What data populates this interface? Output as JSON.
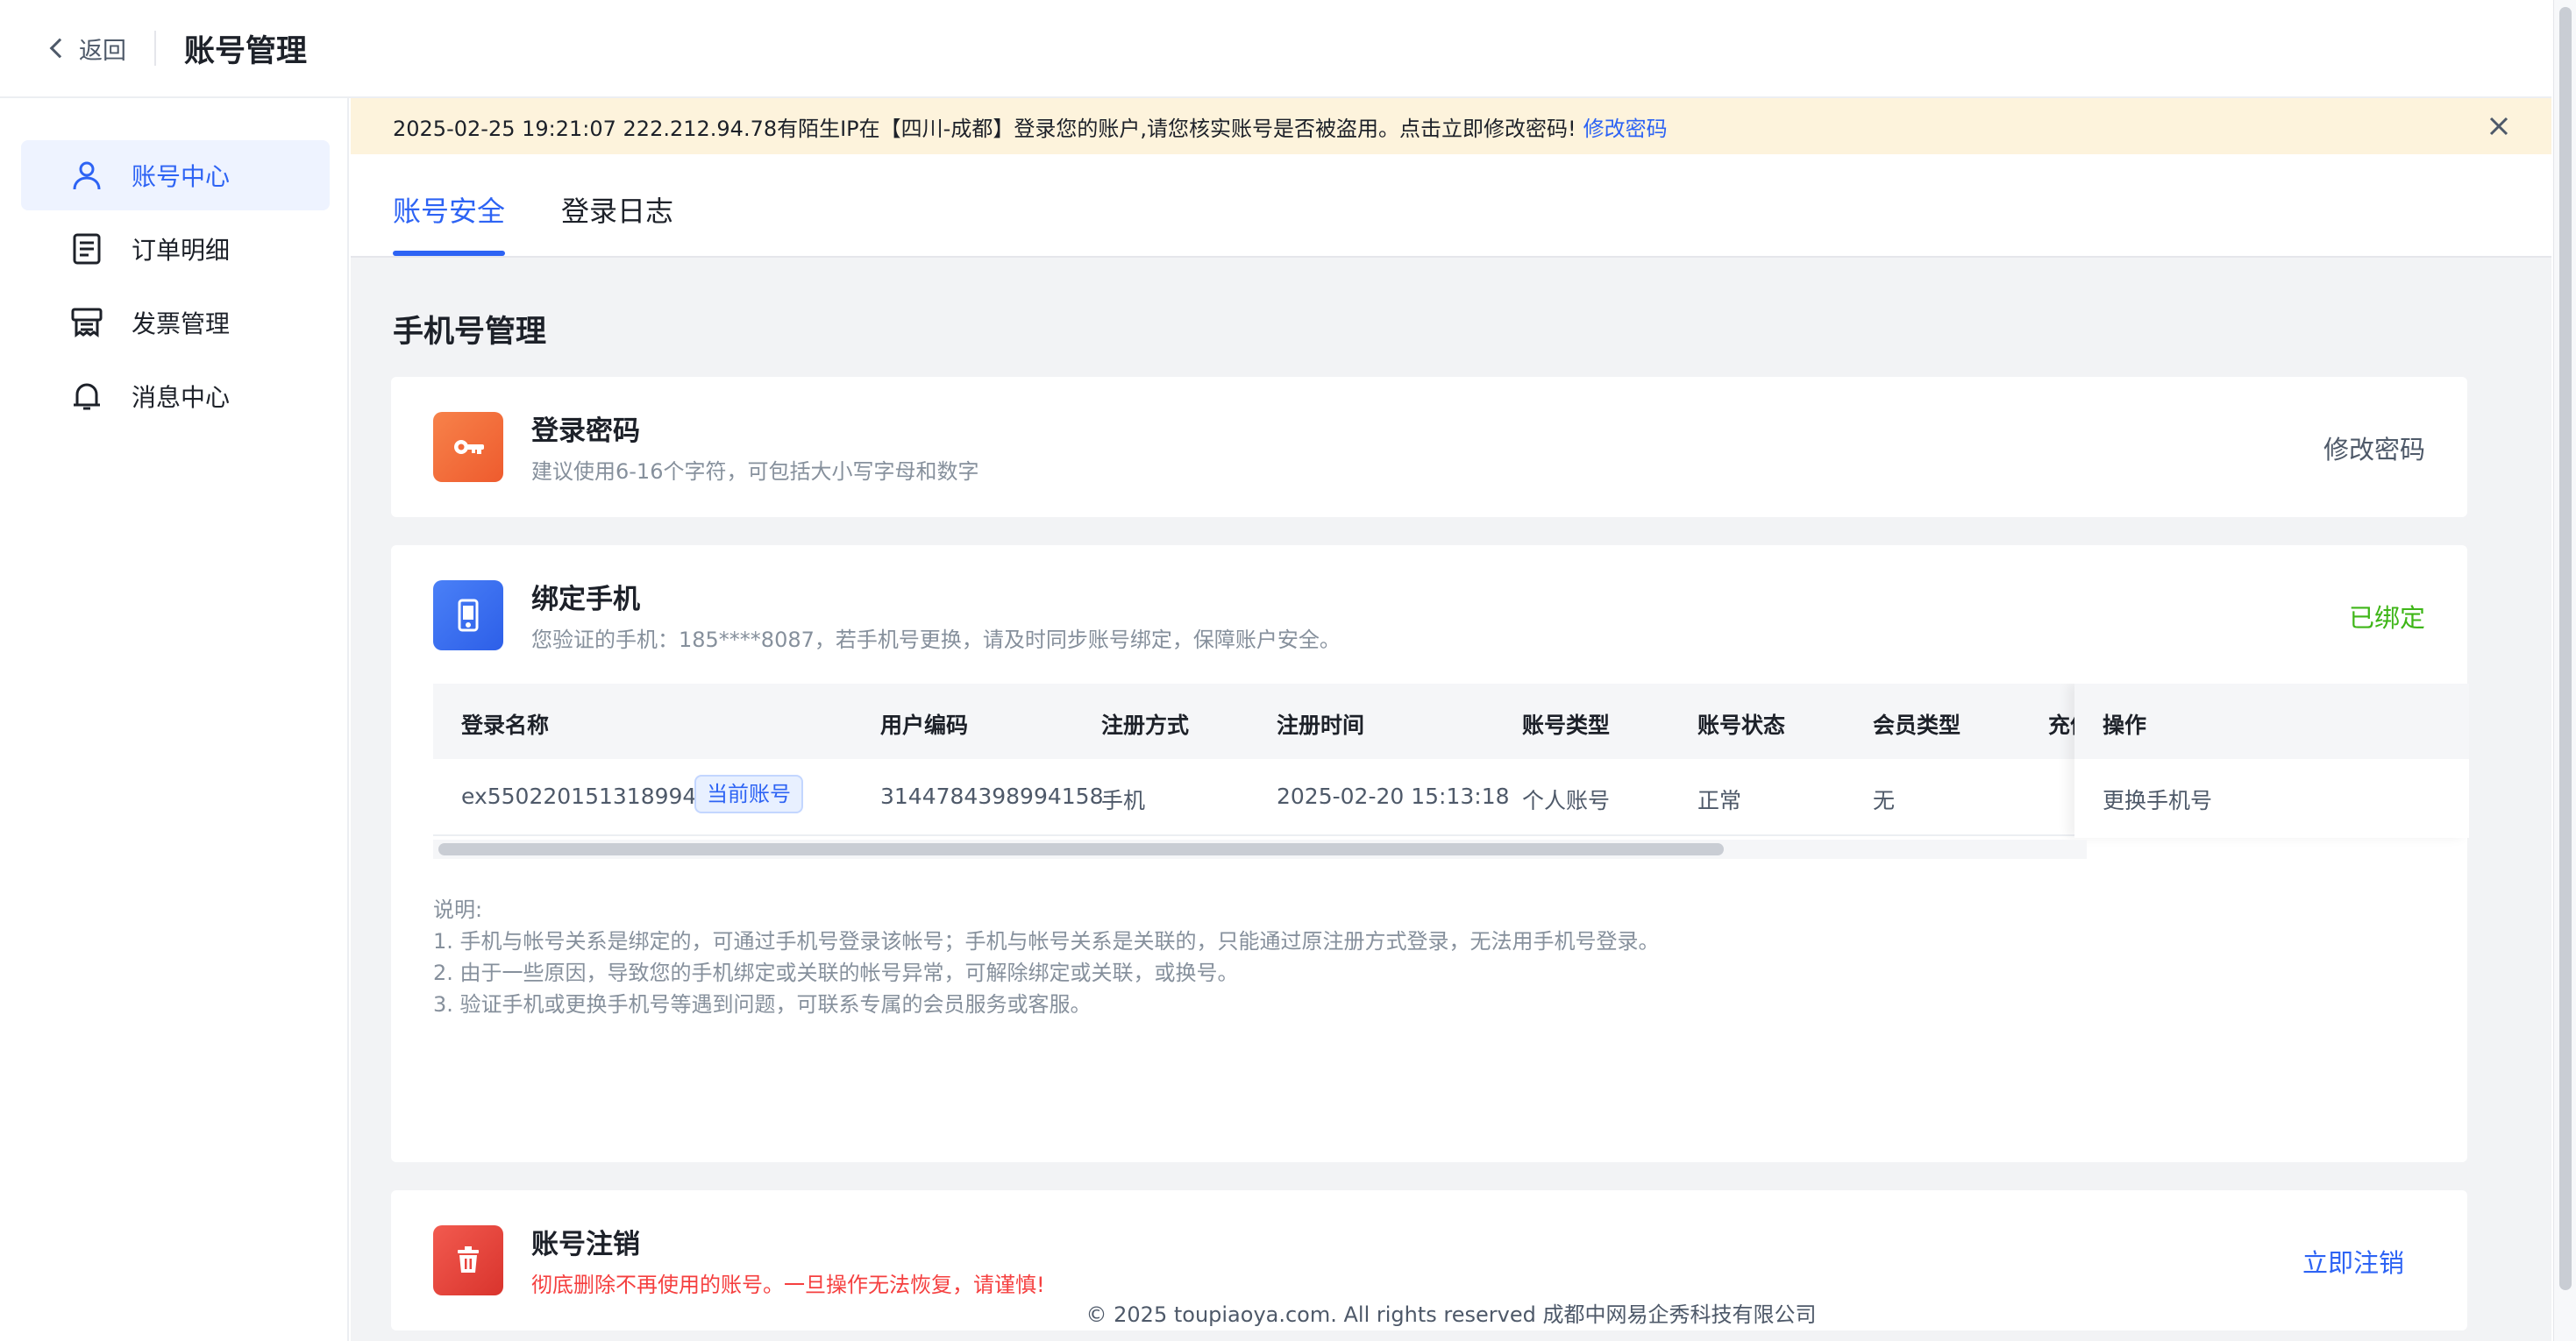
{
  "header": {
    "back_label": "返回",
    "title": "账号管理"
  },
  "sidebar": {
    "items": [
      {
        "label": "账号中心",
        "icon": "user-icon",
        "active": true
      },
      {
        "label": "订单明细",
        "icon": "document-list-icon"
      },
      {
        "label": "发票管理",
        "icon": "invoice-icon"
      },
      {
        "label": "消息中心",
        "icon": "bell-icon"
      }
    ]
  },
  "alert": {
    "text": "2025-02-25 19:21:07 222.212.94.78有陌生IP在【四川-成都】登录您的账户,请您核实账号是否被盗用。点击立即修改密码!",
    "link": "修改密码"
  },
  "tabs": [
    {
      "label": "账号安全",
      "active": true
    },
    {
      "label": "登录日志"
    }
  ],
  "section_title": "手机号管理",
  "password_card": {
    "title": "登录密码",
    "subtitle": "建议使用6-16个字符，可包括大小写字母和数字",
    "action": "修改密码"
  },
  "phone_card": {
    "title": "绑定手机",
    "subtitle": "您验证的手机：185****8087，若手机号更换，请及时同步账号绑定，保障账户安全。",
    "status": "已绑定",
    "table": {
      "headers": [
        "登录名称",
        "用户编码",
        "注册方式",
        "注册时间",
        "账号类型",
        "账号状态",
        "会员类型",
        "充值",
        "操作"
      ],
      "row": {
        "login_name": "ex550220151318994...",
        "badge": "当前账号",
        "user_code": "3144784398994158",
        "reg_method": "手机",
        "reg_time": "2025-02-20 15:13:18",
        "account_type": "个人账号",
        "account_status": "正常",
        "member_type": "无",
        "action": "更换手机号"
      }
    },
    "notes": {
      "title": "说明:",
      "lines": [
        "1. 手机与帐号关系是绑定的，可通过手机号登录该帐号；手机与帐号关系是关联的，只能通过原注册方式登录，无法用手机号登录。",
        "2. 由于一些原因，导致您的手机绑定或关联的帐号异常，可解除绑定或关联，或换号。",
        "3. 验证手机或更换手机号等遇到问题，可联系专属的会员服务或客服。"
      ]
    }
  },
  "cancel_card": {
    "title": "账号注销",
    "subtitle": "彻底删除不再使用的账号。一旦操作无法恢复，请谨慎!",
    "action": "立即注销"
  },
  "footer": "© 2025 toupiaoya.com. All rights reserved 成都中网易企秀科技有限公司",
  "colors": {
    "accent": "#2d63f4",
    "success": "#3fb618",
    "danger": "#f53f3f",
    "alert_bg": "#fdf3dc",
    "key_icon_bg": "#f26b3a",
    "phone_icon_bg": "#3a6ff5",
    "delete_icon_bg": "#e8423b"
  }
}
